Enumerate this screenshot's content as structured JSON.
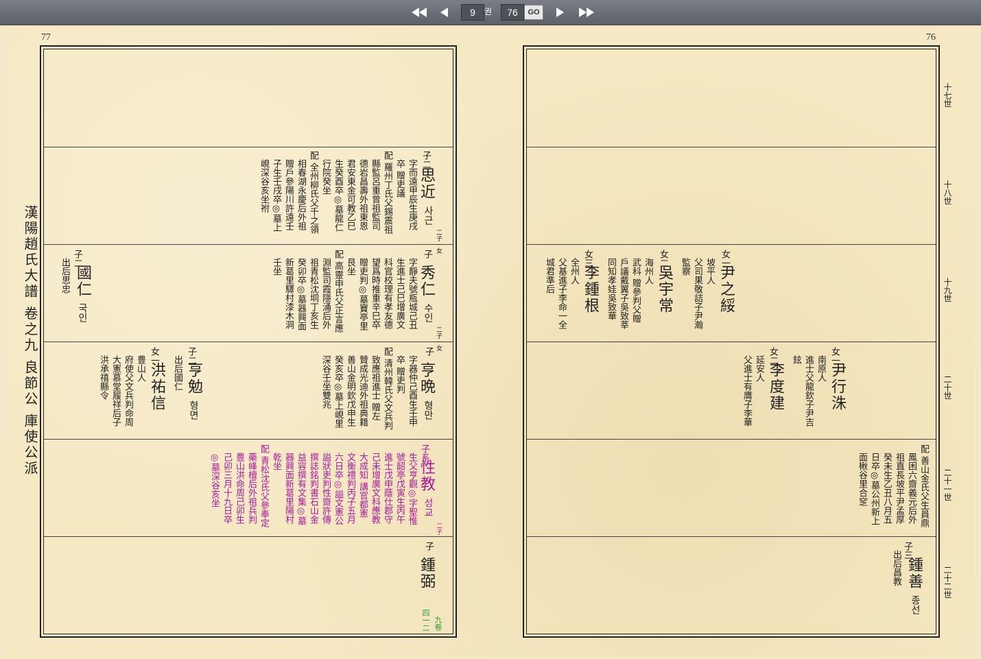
{
  "toolbar": {
    "current_page": "9",
    "vol_label": "권",
    "total_pages": "76",
    "go_label": "GO"
  },
  "left_page": {
    "page_number": "77",
    "side_title": "漢陽趙氏大譜 卷之九 良節公 庫使公派",
    "footer_vol": "九卷",
    "footer_num": "四一二",
    "row2": {
      "e1_rel": "子二",
      "e1_name": "思近",
      "e1_kor": "사근",
      "e1_sub": "二子一女",
      "e1_cols": [
        "字而遠甲辰生庚戌",
        "卒 贈吏議",
        "配 羅州丁氏父錫震祖",
        "縣監呂重曾祖監司",
        "德岩昌壽外祖東恩",
        "君安東金可教乙巳",
        "生癸酉卒◎墓龍仁",
        "行院癸坐",
        "配 全州柳氏父千之領",
        "相春湖永慶后外祖",
        "贈戶參陽川許遠壬",
        "子生壬戌卒◎墓上",
        "峴深谷亥坐祔"
      ]
    },
    "row3": {
      "e1_rel": "子",
      "e1_name": "秀仁",
      "e1_kor": "수인",
      "e1_sub": "二子一女",
      "e1_cols": [
        "字靜夫號瓶城己丑",
        "生進士己巳增廣文",
        "科官校理有孝友德",
        "望爲時推重辛巳卒",
        "贈吏判◎墓寶亭里",
        "艮坐",
        "配 高靈申氏父正言應",
        "淵監司霞隱涌后外",
        "祖青松沈垌丁亥生",
        "癸卯卒◎墓器興面",
        "新葛里驛村漆木洞",
        "壬坐"
      ],
      "e2_rel": "子二",
      "e2_name": "國仁",
      "e2_kor": "국인",
      "e2_cols": [
        "出后思忠"
      ]
    },
    "row4": {
      "e1_rel": "子",
      "e1_name": "亨晩",
      "e1_kor": "형만",
      "e1_cols": [
        "字器仲己酉生壬申",
        "卒 贈吏判",
        "配 清州韓氏父文兵判",
        "致應祖進士 贈左",
        "贊成光迪外祖典籍",
        "善山金明欽戊申生",
        "癸亥卒◎墓上峴里",
        "深谷壬坐雙兆"
      ],
      "e2_rel": "子二",
      "e2_name": "亨勉",
      "e2_kor": "형면",
      "e2_cols": [
        "出后國仁"
      ],
      "e3_rel": "女一",
      "e3_name": "洪祐信",
      "e3_cols": [
        "豊山人",
        "府使父文兵判命周",
        "大憲慕堂履祥后子",
        "洪承禧縣令"
      ]
    },
    "row5": {
      "e1_rel": "子系",
      "e1_name": "性教",
      "e1_kor": "성교",
      "e1_sub": "二子",
      "e1_cols": [
        "生父亨觀◎字聖惟",
        "號韶亭戊寅生丙午",
        "進士戊申蔭仕郡守",
        "己未增廣文科應教",
        "大成知 講官都憲",
        "文衡禮判丙子五月",
        "六日卒◎謚文憲公",
        "謚狀吏判性齋許傳",
        "撰誌銘判書石山金",
        "益容撰有文集◎墓",
        "器興面新葛里陽村",
        "乾坐",
        "配 青松沈氏父參奉定",
        "藥峰檀后外祖兵判",
        "豊山洪命周己卯生",
        "己卯三月十九日卒",
        "◎墓深谷亥坐"
      ]
    },
    "row6": {
      "e1_rel": "子",
      "e1_name": "鍾弼"
    }
  },
  "right_page": {
    "page_number": "76",
    "generations": [
      "十七世",
      "十八世",
      "十九世",
      "二十世",
      "二十一世",
      "二十二世"
    ],
    "row3": {
      "e1_rel": "女一",
      "e1_name": "尹之綏",
      "e1_cols": [
        "坡平人",
        "父司果敬詰子尹瀚",
        "監察"
      ],
      "e2_rel": "女二",
      "e2_name": "吳宇常",
      "e2_cols": [
        "海州人",
        "武科 贈參判父贈",
        "戶議戴翼子吳致莘",
        "同知孝娃吳致華"
      ],
      "e3_rel": "女三",
      "e3_name": "李鍾根",
      "e3_cols": [
        "全州人",
        "父基進子李命一全",
        "城君準后"
      ]
    },
    "row4": {
      "e1_rel": "女一",
      "e1_name": "尹行洙",
      "e1_cols": [
        "南原人",
        "進士父龍欽子尹吉",
        "鉉"
      ],
      "e2_rel": "女二",
      "e2_name": "李度建",
      "e2_cols": [
        "延安人",
        "父進士有膺子李華"
      ]
    },
    "row5": {
      "cols": [
        "配 善山金氏父生員鼎",
        "鳳困六齋義元后外",
        "祖直長坡平尹孟厚",
        "癸未生乙丑八月五",
        "日卒◎墓公州新上",
        "面楸谷里合窆"
      ]
    },
    "row6": {
      "e1_rel": "子三",
      "e1_name": "鍾善",
      "e1_kor": "종선",
      "e1_cols": [
        "出后昌教"
      ]
    }
  }
}
